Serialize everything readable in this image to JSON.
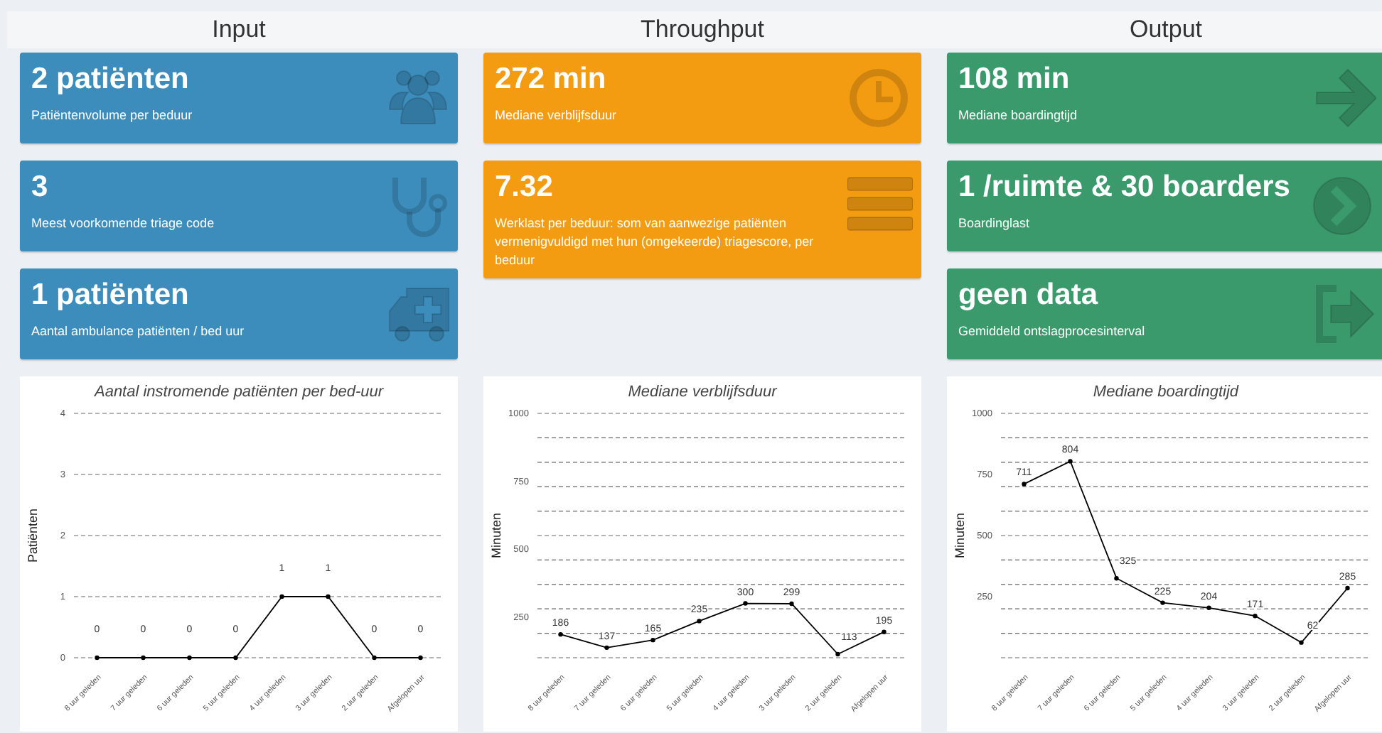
{
  "columns": [
    {
      "title": "Input",
      "color": "#3c8dbc",
      "cards": [
        {
          "value": "2 patiënten",
          "label": "Patiëntenvolume per beduur"
        },
        {
          "value": "3",
          "label": "Meest voorkomende triage code"
        },
        {
          "value": "1 patiënten",
          "label": "Aantal ambulance patiënten / bed uur"
        }
      ],
      "chart": {
        "chart_data": {
          "type": "line",
          "title": "Aantal instromende patiënten per bed-uur",
          "ylabel": "Patiënten",
          "categories": [
            "8 uur geleden",
            "7 uur geleden",
            "6 uur geleden",
            "5 uur geleden",
            "4 uur geleden",
            "3 uur geleden",
            "2 uur geleden",
            "Afgelopen uur"
          ],
          "series": [
            {
              "color": "#000000",
              "values": [
                0,
                0,
                0,
                0,
                1,
                1,
                0,
                0
              ],
              "marker": true
            }
          ],
          "ylim": [
            0,
            4
          ],
          "yticks": [
            0,
            1,
            2,
            3,
            4
          ],
          "grid": true,
          "data_labels": true
        }
      }
    },
    {
      "title": "Throughput",
      "color": "#f39c12",
      "cards": [
        {
          "value": "272 min",
          "label": "Mediane verblijfsduur"
        },
        {
          "value": "7.32",
          "label": "Werklast per beduur: som van aanwezige patiënten vermenigvuldigd met hun (omgekeerde) triagescore, per beduur"
        }
      ],
      "chart": {
        "chart_data": {
          "type": "line",
          "title": "Mediane verblijfsduur",
          "ylabel": "Minuten",
          "categories": [
            "8 uur geleden",
            "7 uur geleden",
            "6 uur geleden",
            "5 uur geleden",
            "4 uur geleden",
            "3 uur geleden",
            "2 uur geleden",
            "Afgelopen uur"
          ],
          "series": [
            {
              "color": "#000000",
              "values": [
                186,
                137,
                165,
                235,
                300,
                299,
                113,
                195
              ],
              "marker": true
            }
          ],
          "ylim": [
            100,
            1000
          ],
          "yticks": [
            250,
            500,
            750,
            1000
          ],
          "grid": true,
          "data_labels": true
        }
      }
    },
    {
      "title": "Output",
      "color": "#3a9a6c",
      "cards": [
        {
          "value": "108 min",
          "label": "Mediane boardingtijd"
        },
        {
          "value": "1 /ruimte & 30 boarders",
          "label": "Boardinglast"
        },
        {
          "value": "geen data",
          "label": "Gemiddeld ontslagprocesinterval"
        }
      ],
      "chart": {
        "chart_data": {
          "type": "line",
          "title": "Mediane boardingtijd",
          "ylabel": "Minuten",
          "categories": [
            "8 uur geleden",
            "7 uur geleden",
            "6 uur geleden",
            "5 uur geleden",
            "4 uur geleden",
            "3 uur geleden",
            "2 uur geleden",
            "Afgelopen uur"
          ],
          "series": [
            {
              "color": "#000000",
              "values": [
                711,
                804,
                325,
                225,
                204,
                171,
                62,
                285
              ],
              "marker": true
            }
          ],
          "ylim": [
            0,
            1000
          ],
          "yticks": [
            250,
            500,
            750,
            1000
          ],
          "grid": true,
          "data_labels": true
        }
      }
    }
  ]
}
